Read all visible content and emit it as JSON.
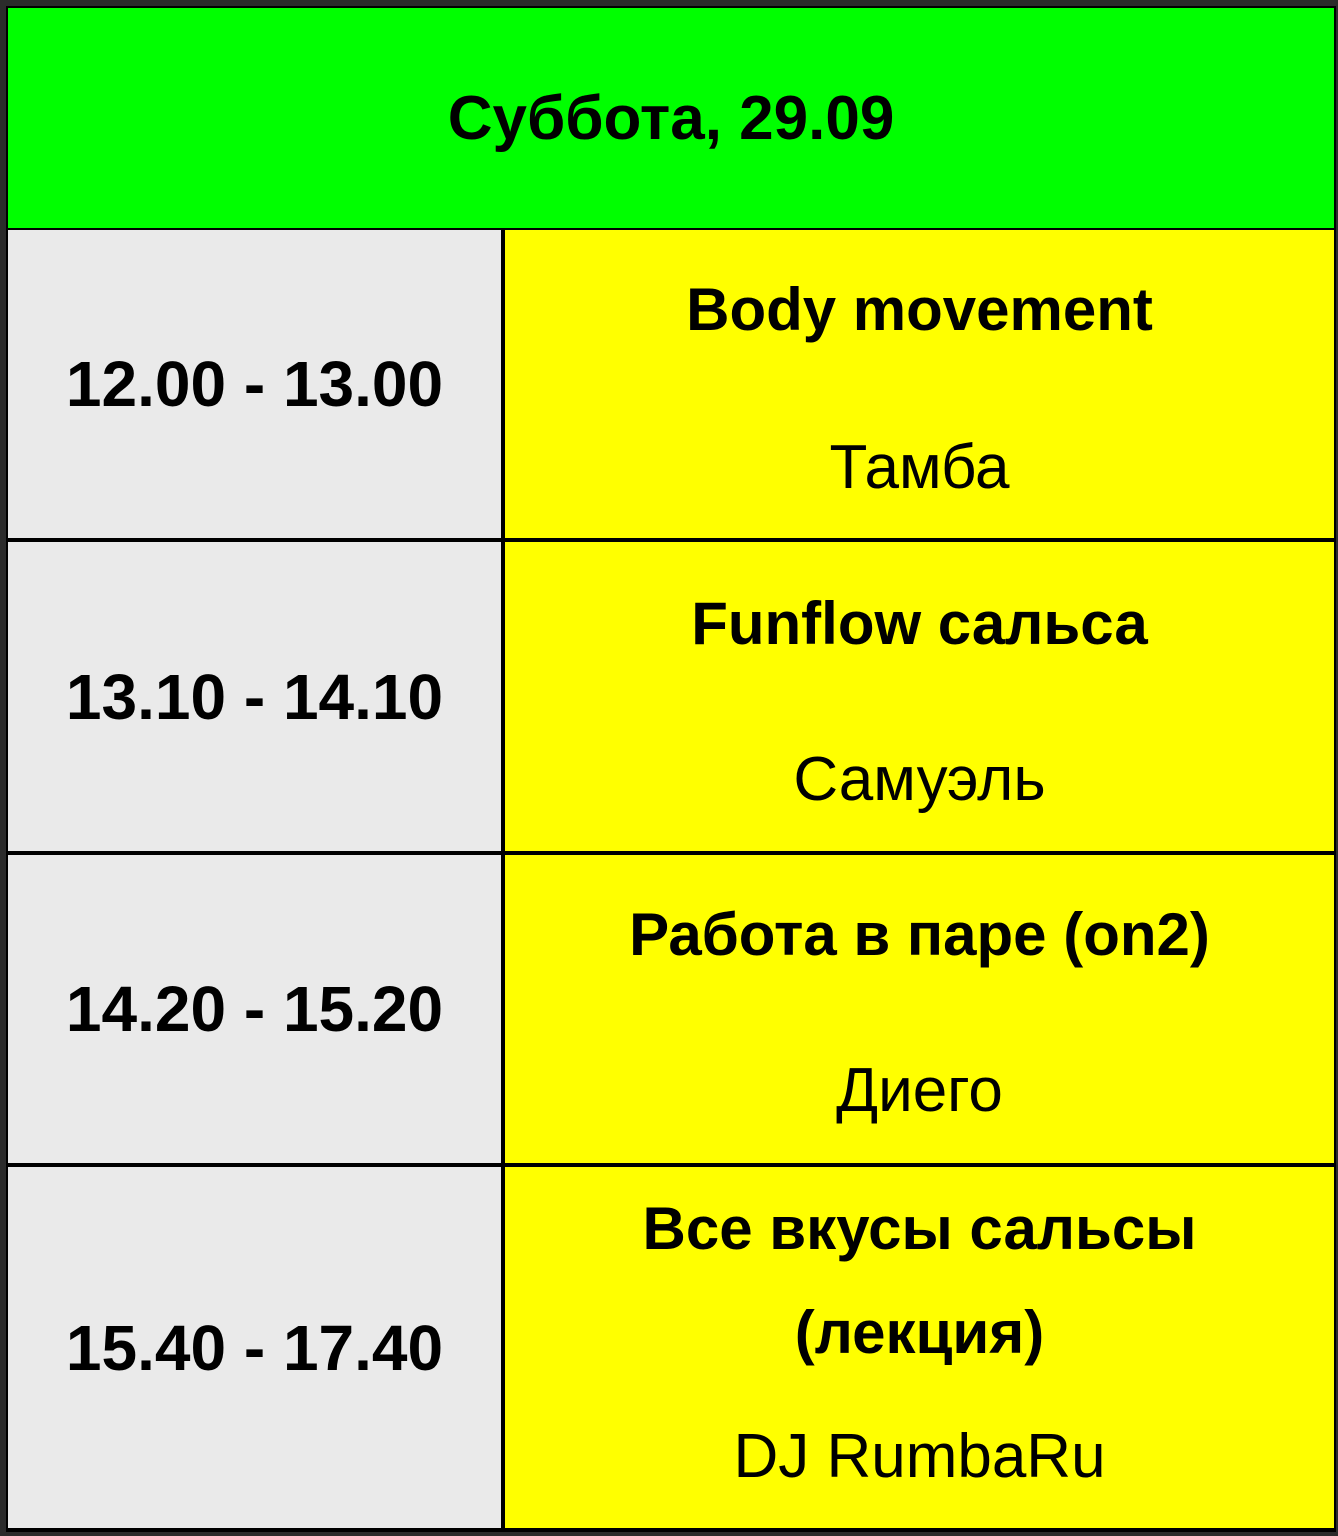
{
  "header": {
    "title": "Суббота, 29.09"
  },
  "schedule": [
    {
      "time": "12.00 - 13.00",
      "title": "Body movement",
      "host": "Тамба"
    },
    {
      "time": "13.10 - 14.10",
      "title": "Funflow сальса",
      "host": "Самуэль"
    },
    {
      "time": "14.20 - 15.20",
      "title": "Работа в паре (on2)",
      "host": "Диего"
    },
    {
      "time": "15.40 - 17.40",
      "title_line1": "Все вкусы сальсы",
      "title_line2": "(лекция)",
      "host": "DJ RumbaRu"
    }
  ],
  "colors": {
    "header_bg": "#00ff00",
    "time_bg": "#eaeaea",
    "event_bg": "#ffff00",
    "border": "#000000"
  }
}
